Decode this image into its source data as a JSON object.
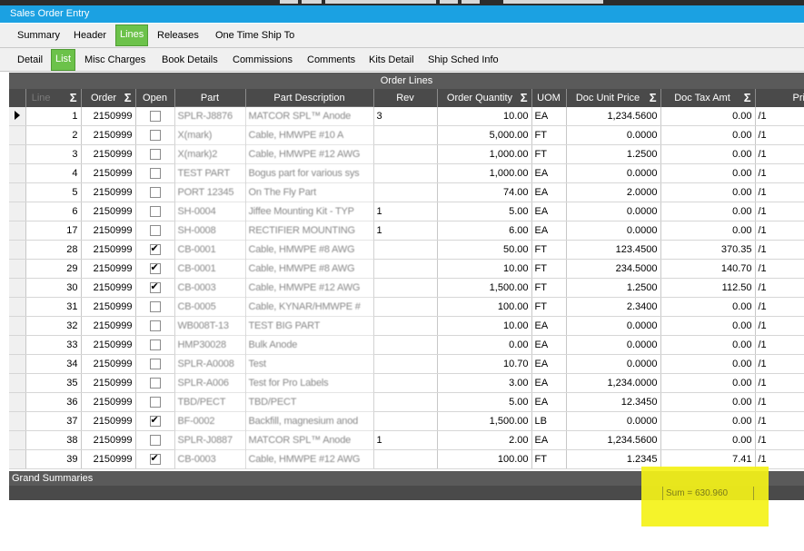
{
  "window": {
    "title": "Sales Order Entry"
  },
  "main_tabs": [
    {
      "label": "Summary",
      "active": false
    },
    {
      "label": "Header",
      "active": false
    },
    {
      "label": "Lines",
      "active": true
    },
    {
      "label": "Releases",
      "active": false
    },
    {
      "label": "One Time Ship To",
      "active": false
    }
  ],
  "sub_tabs": [
    {
      "label": "Detail",
      "active": false
    },
    {
      "label": "List",
      "active": true
    },
    {
      "label": "Misc Charges",
      "active": false
    },
    {
      "label": "Book Details",
      "active": false
    },
    {
      "label": "Commissions",
      "active": false
    },
    {
      "label": "Comments",
      "active": false
    },
    {
      "label": "Kits Detail",
      "active": false
    },
    {
      "label": "Ship Sched Info",
      "active": false
    }
  ],
  "grid": {
    "title": "Order Lines",
    "columns": [
      "Line",
      "Order",
      "Open",
      "Part",
      "Part Description",
      "Rev",
      "Order Quantity",
      "UOM",
      "Doc Unit Price",
      "Doc Tax Amt",
      "Pric"
    ],
    "rows": [
      {
        "line": "1",
        "order": "2150999",
        "open": false,
        "part": "SPLR-J8876",
        "desc": "MATCOR SPL™ Anode",
        "rev": "3",
        "qty": "10.00",
        "uom": "EA",
        "price": "1,234.5600",
        "tax": "0.00",
        "pric": "/1"
      },
      {
        "line": "2",
        "order": "2150999",
        "open": false,
        "part": "X(mark)",
        "desc": "Cable, HMWPE #10 A",
        "rev": "",
        "qty": "5,000.00",
        "uom": "FT",
        "price": "0.0000",
        "tax": "0.00",
        "pric": "/1"
      },
      {
        "line": "3",
        "order": "2150999",
        "open": false,
        "part": "X(mark)2",
        "desc": "Cable, HMWPE #12 AWG",
        "rev": "",
        "qty": "1,000.00",
        "uom": "FT",
        "price": "1.2500",
        "tax": "0.00",
        "pric": "/1"
      },
      {
        "line": "4",
        "order": "2150999",
        "open": false,
        "part": "TEST PART",
        "desc": "Bogus part for various sys",
        "rev": "",
        "qty": "1,000.00",
        "uom": "EA",
        "price": "0.0000",
        "tax": "0.00",
        "pric": "/1"
      },
      {
        "line": "5",
        "order": "2150999",
        "open": false,
        "part": "PORT 12345",
        "desc": "On The Fly Part",
        "rev": "",
        "qty": "74.00",
        "uom": "EA",
        "price": "2.0000",
        "tax": "0.00",
        "pric": "/1"
      },
      {
        "line": "6",
        "order": "2150999",
        "open": false,
        "part": "SH-0004",
        "desc": "Jiffee Mounting Kit - TYP",
        "rev": "1",
        "qty": "5.00",
        "uom": "EA",
        "price": "0.0000",
        "tax": "0.00",
        "pric": "/1"
      },
      {
        "line": "17",
        "order": "2150999",
        "open": false,
        "part": "SH-0008",
        "desc": "RECTIFIER MOUNTING",
        "rev": "1",
        "qty": "6.00",
        "uom": "EA",
        "price": "0.0000",
        "tax": "0.00",
        "pric": "/1"
      },
      {
        "line": "28",
        "order": "2150999",
        "open": true,
        "part": "CB-0001",
        "desc": "Cable, HMWPE #8 AWG",
        "rev": "",
        "qty": "50.00",
        "uom": "FT",
        "price": "123.4500",
        "tax": "370.35",
        "pric": "/1"
      },
      {
        "line": "29",
        "order": "2150999",
        "open": true,
        "part": "CB-0001",
        "desc": "Cable, HMWPE #8 AWG",
        "rev": "",
        "qty": "10.00",
        "uom": "FT",
        "price": "234.5000",
        "tax": "140.70",
        "pric": "/1"
      },
      {
        "line": "30",
        "order": "2150999",
        "open": true,
        "part": "CB-0003",
        "desc": "Cable, HMWPE #12 AWG",
        "rev": "",
        "qty": "1,500.00",
        "uom": "FT",
        "price": "1.2500",
        "tax": "112.50",
        "pric": "/1"
      },
      {
        "line": "31",
        "order": "2150999",
        "open": false,
        "part": "CB-0005",
        "desc": "Cable, KYNAR/HMWPE #",
        "rev": "",
        "qty": "100.00",
        "uom": "FT",
        "price": "2.3400",
        "tax": "0.00",
        "pric": "/1"
      },
      {
        "line": "32",
        "order": "2150999",
        "open": false,
        "part": "WB008T-13",
        "desc": "TEST BIG PART",
        "rev": "",
        "qty": "10.00",
        "uom": "EA",
        "price": "0.0000",
        "tax": "0.00",
        "pric": "/1"
      },
      {
        "line": "33",
        "order": "2150999",
        "open": false,
        "part": "HMP30028",
        "desc": "Bulk Anode",
        "rev": "",
        "qty": "0.00",
        "uom": "EA",
        "price": "0.0000",
        "tax": "0.00",
        "pric": "/1"
      },
      {
        "line": "34",
        "order": "2150999",
        "open": false,
        "part": "SPLR-A0008",
        "desc": "Test",
        "rev": "",
        "qty": "10.70",
        "uom": "EA",
        "price": "0.0000",
        "tax": "0.00",
        "pric": "/1"
      },
      {
        "line": "35",
        "order": "2150999",
        "open": false,
        "part": "SPLR-A006",
        "desc": "Test for Pro Labels",
        "rev": "",
        "qty": "3.00",
        "uom": "EA",
        "price": "1,234.0000",
        "tax": "0.00",
        "pric": "/1"
      },
      {
        "line": "36",
        "order": "2150999",
        "open": false,
        "part": "TBD/PECT",
        "desc": "TBD/PECT",
        "rev": "",
        "qty": "5.00",
        "uom": "EA",
        "price": "12.3450",
        "tax": "0.00",
        "pric": "/1"
      },
      {
        "line": "37",
        "order": "2150999",
        "open": true,
        "part": "BF-0002",
        "desc": "Backfill, magnesium anod",
        "rev": "",
        "qty": "1,500.00",
        "uom": "LB",
        "price": "0.0000",
        "tax": "0.00",
        "pric": "/1"
      },
      {
        "line": "38",
        "order": "2150999",
        "open": false,
        "part": "SPLR-J0887",
        "desc": "MATCOR SPL™ Anode",
        "rev": "1",
        "qty": "2.00",
        "uom": "EA",
        "price": "1,234.5600",
        "tax": "0.00",
        "pric": "/1"
      },
      {
        "line": "39",
        "order": "2150999",
        "open": true,
        "part": "CB-0003",
        "desc": "Cable, HMWPE #12 AWG",
        "rev": "",
        "qty": "100.00",
        "uom": "FT",
        "price": "1.2345",
        "tax": "7.41",
        "pric": "/1"
      }
    ]
  },
  "grand_summaries": {
    "title": "Grand Summaries",
    "tax_sum": "Sum = 630.960"
  },
  "colors": {
    "titlebar": "#1ba1e2",
    "active_tab": "#6cc24a",
    "highlight": "#f4f218"
  }
}
